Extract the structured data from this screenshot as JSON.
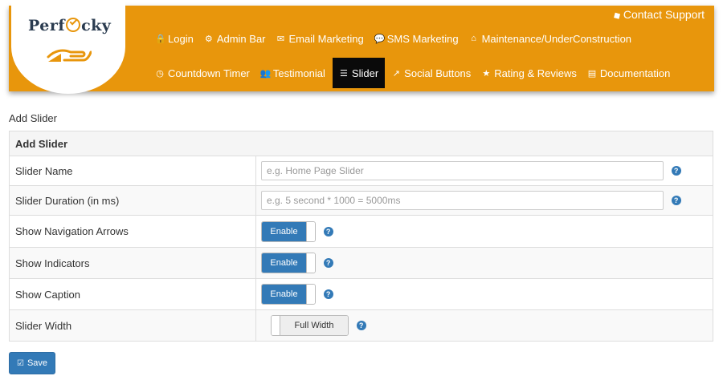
{
  "brand": {
    "logo_text_pre": "Perf",
    "logo_text_post": "cky"
  },
  "header": {
    "contact_label": "Contact Support",
    "nav_row1": [
      {
        "label": "Login",
        "icon": "lock-icon",
        "glyph": "🔒"
      },
      {
        "label": "Admin Bar",
        "icon": "gear-icon",
        "glyph": "⚙"
      },
      {
        "label": "Email Marketing",
        "icon": "envelope-icon",
        "glyph": "✉"
      },
      {
        "label": "SMS Marketing",
        "icon": "chat-icon",
        "glyph": "💬"
      },
      {
        "label": "Maintenance/UnderConstruction",
        "icon": "home-icon",
        "glyph": "⌂"
      }
    ],
    "nav_row2": [
      {
        "label": "Countdown Timer",
        "icon": "clock-icon",
        "glyph": "◷"
      },
      {
        "label": "Testimonial",
        "icon": "users-icon",
        "glyph": "👥"
      },
      {
        "label": "Slider",
        "icon": "sliders-icon",
        "glyph": "☰",
        "active": true
      },
      {
        "label": "Social Buttons",
        "icon": "share-icon",
        "glyph": "↗"
      },
      {
        "label": "Rating & Reviews",
        "icon": "star-icon",
        "glyph": "★"
      },
      {
        "label": "Documentation",
        "icon": "book-icon",
        "glyph": "▤"
      }
    ]
  },
  "page": {
    "title": "Add Slider",
    "table_header": "Add Slider",
    "rows": {
      "slider_name": {
        "label": "Slider Name",
        "placeholder": "e.g. Home Page Slider",
        "value": ""
      },
      "slider_duration": {
        "label": "Slider Duration (in ms)",
        "placeholder": "e.g. 5 second * 1000 = 5000ms",
        "value": ""
      },
      "nav_arrows": {
        "label": "Show Navigation Arrows",
        "toggle": "Enable"
      },
      "indicators": {
        "label": "Show Indicators",
        "toggle": "Enable"
      },
      "caption": {
        "label": "Show Caption",
        "toggle": "Enable"
      },
      "width": {
        "label": "Slider Width",
        "toggle": "Full Width"
      }
    },
    "help_glyph": "?",
    "save_label": "Save"
  },
  "colors": {
    "header": "#e8960c",
    "primary": "#337ab7",
    "active_nav": "#0a0a0a"
  }
}
